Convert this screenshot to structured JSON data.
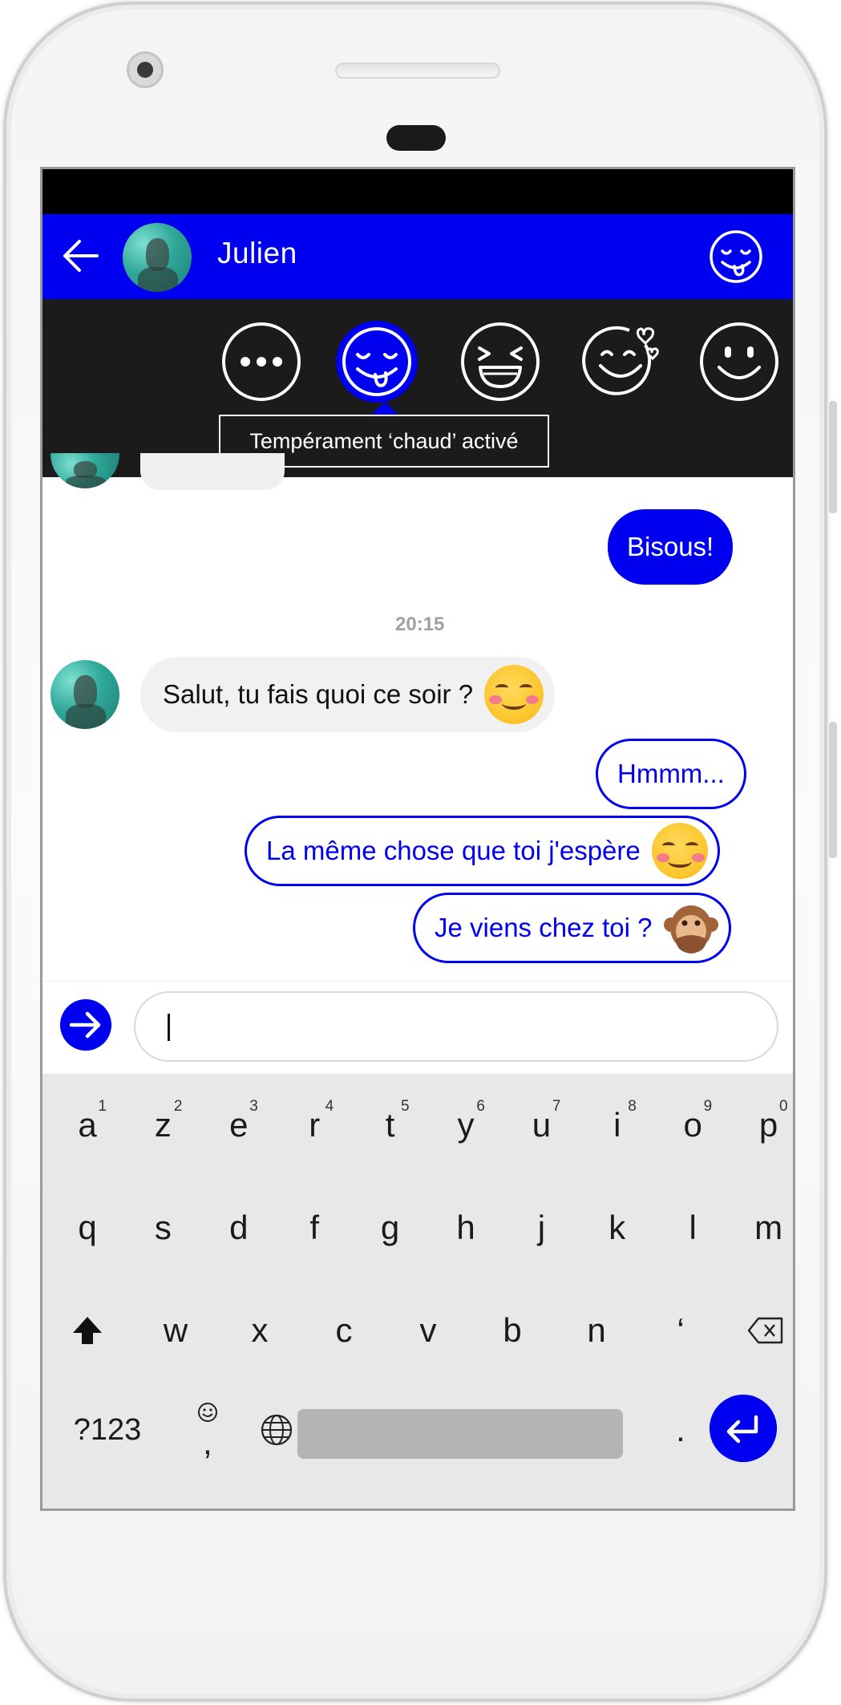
{
  "colors": {
    "accent": "#0000f0",
    "status_bar": "#000000",
    "mood_bar": "#1b1b1b",
    "received_bubble": "#f1f1f1",
    "timestamp": "#a0a0a0"
  },
  "header": {
    "title": "Julien",
    "back_icon": "arrow-left-icon",
    "mood_icon": "tongue-out-face-icon"
  },
  "mood_picker": {
    "options": [
      {
        "icon": "ellipsis-face-icon",
        "active": false
      },
      {
        "icon": "tongue-out-face-icon",
        "active": true
      },
      {
        "icon": "laughing-squint-face-icon",
        "active": false
      },
      {
        "icon": "face-with-hearts-icon",
        "active": false
      },
      {
        "icon": "smiling-face-icon",
        "active": false
      }
    ],
    "tooltip": "Tempérament ‘chaud’ activé"
  },
  "messages": {
    "first_sent": "Bisous!",
    "timestamp": "20:15",
    "received": {
      "text": "Salut, tu fais quoi ce soir ?",
      "emoji": "smiling-blush-emoji"
    },
    "replies": [
      {
        "text": "Hmmm...",
        "emoji": ""
      },
      {
        "text": "La même chose que toi j'espère",
        "emoji": "smiling-blush-emoji"
      },
      {
        "text": "Je viens chez toi ?",
        "emoji": "speak-no-evil-monkey-emoji"
      }
    ]
  },
  "composer": {
    "value": "",
    "send_icon": "arrow-right-icon"
  },
  "keyboard": {
    "row1": [
      {
        "k": "a",
        "hint": "1"
      },
      {
        "k": "z",
        "hint": "2"
      },
      {
        "k": "e",
        "hint": "3"
      },
      {
        "k": "r",
        "hint": "4"
      },
      {
        "k": "t",
        "hint": "5"
      },
      {
        "k": "y",
        "hint": "6"
      },
      {
        "k": "u",
        "hint": "7"
      },
      {
        "k": "i",
        "hint": "8"
      },
      {
        "k": "o",
        "hint": "9"
      },
      {
        "k": "p",
        "hint": "0"
      }
    ],
    "row2": [
      "q",
      "s",
      "d",
      "f",
      "g",
      "h",
      "j",
      "k",
      "l",
      "m"
    ],
    "row3": [
      "w",
      "x",
      "c",
      "v",
      "b",
      "n",
      "‘"
    ],
    "symbols_label": "?123",
    "emoji_comma_label": ",",
    "period_label": ".",
    "shift_icon": "shift-arrow-icon",
    "backspace_icon": "backspace-icon",
    "globe_icon": "globe-icon",
    "emoji_icon": "smiley-icon",
    "enter_icon": "enter-return-icon"
  }
}
